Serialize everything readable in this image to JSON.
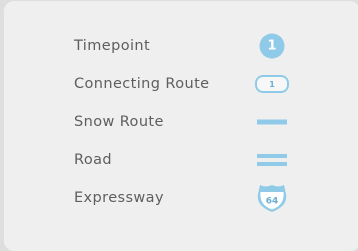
{
  "legend": {
    "items": [
      {
        "label": "Timepoint",
        "symbol": "timepoint-circle-icon",
        "symbol_text": "1"
      },
      {
        "label": "Connecting Route",
        "symbol": "connecting-route-pill-icon",
        "symbol_text": "1"
      },
      {
        "label": "Snow Route",
        "symbol": "snow-route-line-icon"
      },
      {
        "label": "Road",
        "symbol": "road-double-line-icon"
      },
      {
        "label": "Expressway",
        "symbol": "expressway-shield-icon",
        "symbol_text": "64"
      }
    ]
  },
  "colors": {
    "accent": "#8fcbe8",
    "text": "#5e5e5e",
    "panel_background": "#efefef",
    "page_background": "#dedede"
  }
}
